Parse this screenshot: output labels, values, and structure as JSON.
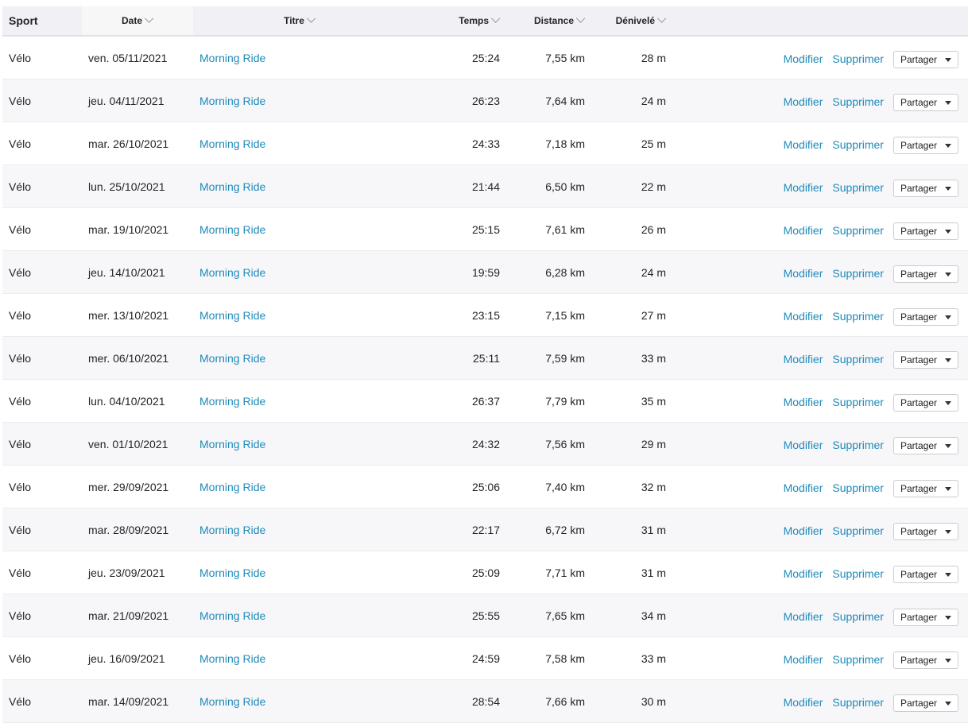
{
  "headers": {
    "sport": "Sport",
    "date": "Date",
    "title": "Titre",
    "time": "Temps",
    "distance": "Distance",
    "elevation": "Dénivelé"
  },
  "actions": {
    "edit": "Modifier",
    "delete": "Supprimer",
    "share": "Partager"
  },
  "rows": [
    {
      "sport": "Vélo",
      "date": "ven. 05/11/2021",
      "title": "Morning Ride",
      "time": "25:24",
      "distance": "7,55 km",
      "elevation": "28 m"
    },
    {
      "sport": "Vélo",
      "date": "jeu. 04/11/2021",
      "title": "Morning Ride",
      "time": "26:23",
      "distance": "7,64 km",
      "elevation": "24 m"
    },
    {
      "sport": "Vélo",
      "date": "mar. 26/10/2021",
      "title": "Morning Ride",
      "time": "24:33",
      "distance": "7,18 km",
      "elevation": "25 m"
    },
    {
      "sport": "Vélo",
      "date": "lun. 25/10/2021",
      "title": "Morning Ride",
      "time": "21:44",
      "distance": "6,50 km",
      "elevation": "22 m"
    },
    {
      "sport": "Vélo",
      "date": "mar. 19/10/2021",
      "title": "Morning Ride",
      "time": "25:15",
      "distance": "7,61 km",
      "elevation": "26 m"
    },
    {
      "sport": "Vélo",
      "date": "jeu. 14/10/2021",
      "title": "Morning Ride",
      "time": "19:59",
      "distance": "6,28 km",
      "elevation": "24 m"
    },
    {
      "sport": "Vélo",
      "date": "mer. 13/10/2021",
      "title": "Morning Ride",
      "time": "23:15",
      "distance": "7,15 km",
      "elevation": "27 m"
    },
    {
      "sport": "Vélo",
      "date": "mer. 06/10/2021",
      "title": "Morning Ride",
      "time": "25:11",
      "distance": "7,59 km",
      "elevation": "33 m"
    },
    {
      "sport": "Vélo",
      "date": "lun. 04/10/2021",
      "title": "Morning Ride",
      "time": "26:37",
      "distance": "7,79 km",
      "elevation": "35 m"
    },
    {
      "sport": "Vélo",
      "date": "ven. 01/10/2021",
      "title": "Morning Ride",
      "time": "24:32",
      "distance": "7,56 km",
      "elevation": "29 m"
    },
    {
      "sport": "Vélo",
      "date": "mer. 29/09/2021",
      "title": "Morning Ride",
      "time": "25:06",
      "distance": "7,40 km",
      "elevation": "32 m"
    },
    {
      "sport": "Vélo",
      "date": "mar. 28/09/2021",
      "title": "Morning Ride",
      "time": "22:17",
      "distance": "6,72 km",
      "elevation": "31 m"
    },
    {
      "sport": "Vélo",
      "date": "jeu. 23/09/2021",
      "title": "Morning Ride",
      "time": "25:09",
      "distance": "7,71 km",
      "elevation": "31 m"
    },
    {
      "sport": "Vélo",
      "date": "mar. 21/09/2021",
      "title": "Morning Ride",
      "time": "25:55",
      "distance": "7,65 km",
      "elevation": "34 m"
    },
    {
      "sport": "Vélo",
      "date": "jeu. 16/09/2021",
      "title": "Morning Ride",
      "time": "24:59",
      "distance": "7,58 km",
      "elevation": "33 m"
    },
    {
      "sport": "Vélo",
      "date": "mar. 14/09/2021",
      "title": "Morning Ride",
      "time": "28:54",
      "distance": "7,66 km",
      "elevation": "30 m"
    }
  ]
}
